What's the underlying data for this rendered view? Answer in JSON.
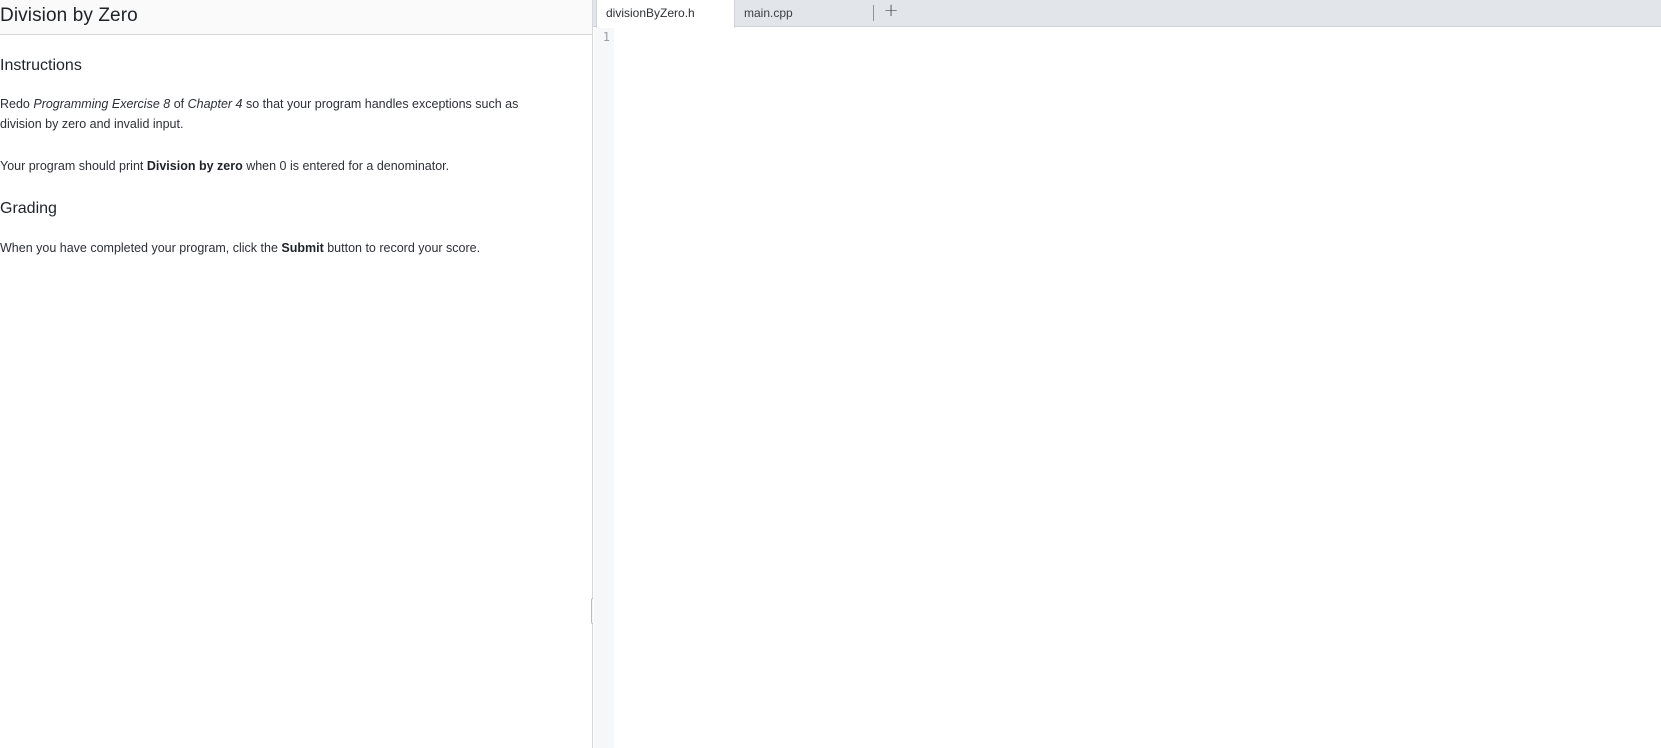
{
  "instructions": {
    "title": "Division by Zero",
    "instructions_heading": "Instructions",
    "p1": {
      "t1": "Redo ",
      "em1": "Programming Exercise 8",
      "t2": " of ",
      "em2": "Chapter 4",
      "t3": " so that your program handles exceptions such as division by zero and invalid input."
    },
    "p2": {
      "t1": "Your program should print ",
      "strong": "Division by zero",
      "t2": " when 0 is entered for a denominator."
    },
    "grading_heading": "Grading",
    "p3": {
      "t1": "When you have completed your program, click the ",
      "strong": "Submit",
      "t2": " button to record your score."
    }
  },
  "editor": {
    "tabs": [
      {
        "label": "divisionByZero.h",
        "active": true
      },
      {
        "label": "main.cpp",
        "active": false
      }
    ],
    "add_tab_icon": "plus-icon",
    "line_numbers": [
      "1"
    ]
  }
}
